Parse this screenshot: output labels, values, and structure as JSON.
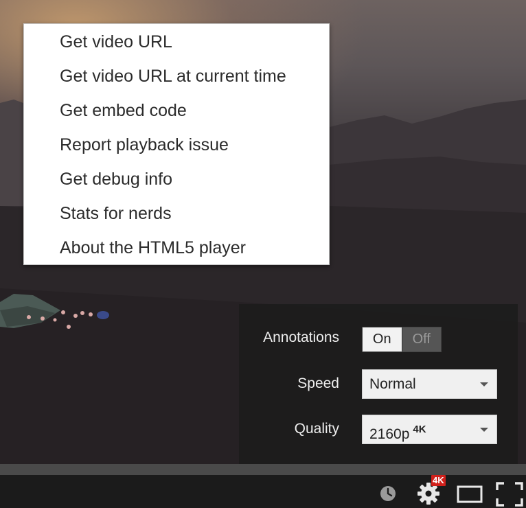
{
  "context_menu": {
    "items": [
      {
        "label": "Get video URL"
      },
      {
        "label": "Get video URL at current time"
      },
      {
        "label": "Get embed code"
      },
      {
        "label": "Report playback issue"
      },
      {
        "label": "Get debug info"
      },
      {
        "label": "Stats for nerds"
      },
      {
        "label": "About the HTML5 player"
      }
    ]
  },
  "settings": {
    "annotations": {
      "label": "Annotations",
      "on": "On",
      "off": "Off",
      "selected": "On"
    },
    "speed": {
      "label": "Speed",
      "value": "Normal"
    },
    "quality": {
      "label": "Quality",
      "value": "2160p",
      "badge": "4K"
    }
  },
  "controls": {
    "settings_badge": "4K",
    "icons": [
      "watch-later-icon",
      "settings-gear-icon",
      "theater-mode-icon",
      "fullscreen-icon"
    ]
  },
  "colors": {
    "badge_red": "#d0201b",
    "panel_bg": "#1c1c1c",
    "menu_bg": "#ffffff"
  }
}
